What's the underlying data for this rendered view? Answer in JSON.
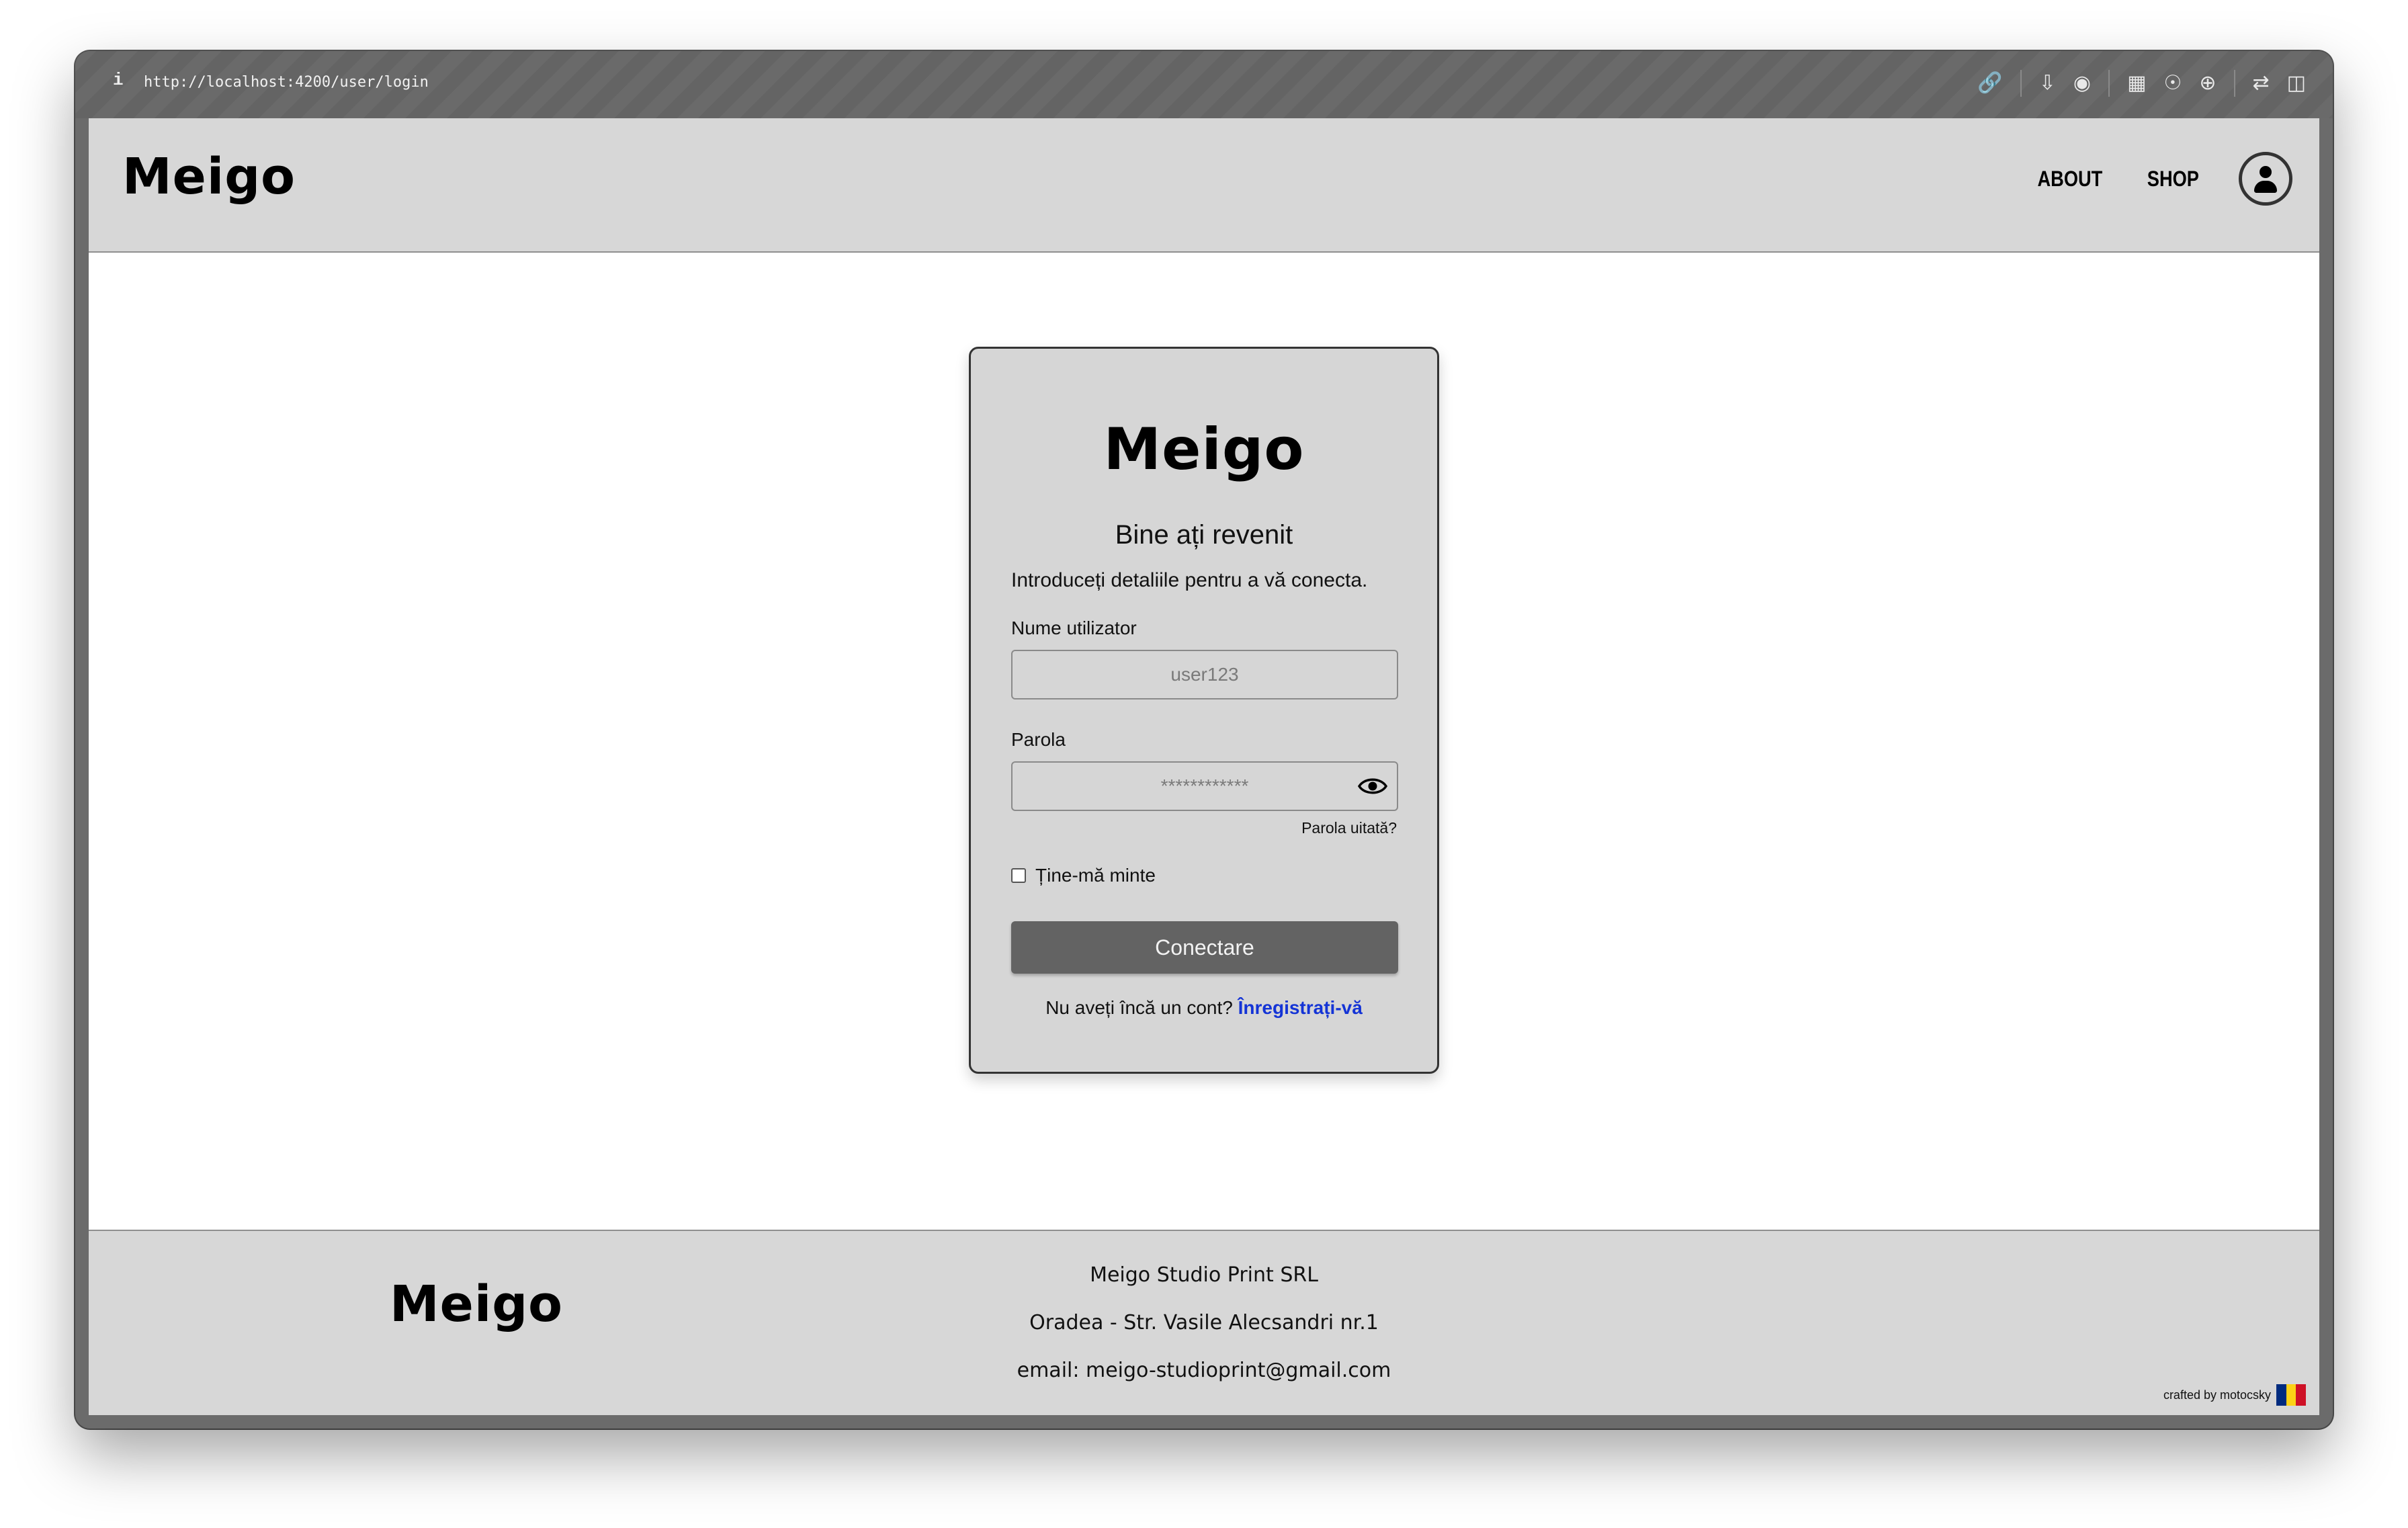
{
  "browser": {
    "info_icon": "i",
    "url": "http://localhost:4200/user/login",
    "tool_icons": [
      "link-icon",
      "download-icon",
      "camera-icon",
      "terminal-icon",
      "globe-icon",
      "crosshair-icon",
      "extensions-icon",
      "sidebar-icon"
    ]
  },
  "header": {
    "logo": "Meigo",
    "nav": {
      "about": "ABOUT",
      "shop": "SHOP"
    },
    "account_icon": "user-circle-icon"
  },
  "login": {
    "logo": "Meigo",
    "title": "Bine ați revenit",
    "subtitle": "Introduceți detaliile pentru a vă conecta.",
    "username_label": "Nume utilizator",
    "username_placeholder": "user123",
    "password_label": "Parola",
    "password_placeholder": "************",
    "forgot": "Parola uitată?",
    "remember": "Ține-mă minte",
    "submit": "Conectare",
    "signup_prompt": "Nu aveți încă un cont?",
    "signup_link": "Înregistrați-vă"
  },
  "footer": {
    "logo": "Meigo",
    "company": "Meigo Studio Print SRL",
    "address": "Oradea - Str. Vasile Alecsandri nr.1",
    "email": "email: meigo-studioprint@gmail.com",
    "crafted": "crafted by motocsky"
  },
  "colors": {
    "surface": "#d7d7d7",
    "button": "#636363",
    "link": "#1434d6",
    "flag": [
      "#002b7f",
      "#fcd116",
      "#ce1126"
    ]
  }
}
